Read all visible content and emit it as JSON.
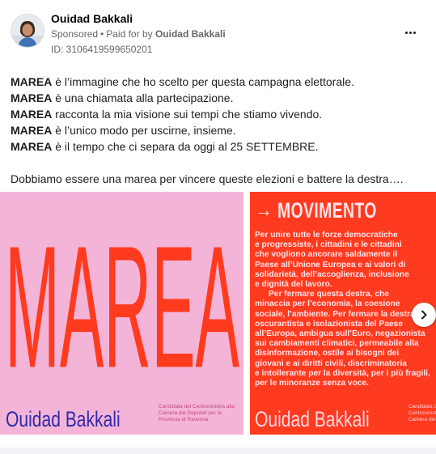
{
  "post": {
    "page_name": "Ouidad Bakkali",
    "sponsored": "Sponsored",
    "paid_for_prefix": "Paid for by",
    "paid_for_by": "Ouidad Bakkali",
    "ad_id": "ID: 3106419599650201",
    "body_lines": [
      {
        "bold": "MAREA",
        "rest": " è l’immagine che ho scelto per questa campagna elettorale."
      },
      {
        "bold": "MAREA",
        "rest": " è una chiamata alla partecipazione."
      },
      {
        "bold": "MAREA",
        "rest": " racconta la mia visione sui tempi che stiamo vivendo."
      },
      {
        "bold": "MAREA",
        "rest": " è l’unico modo per uscirne, insieme."
      },
      {
        "bold": "MAREA",
        "rest": " è il tempo che ci separa da oggi al 25 SETTEMBRE."
      }
    ],
    "body_closing": "Dobbiamo essere una marea per vincere queste elezioni e battere la destra…."
  },
  "carousel": {
    "slide_1": {
      "big_word": "MAREA",
      "name": "Ouidad Bakkali",
      "note": "Candidata del Centrosinistra alla Camera dei Deputati per la Provincia di Ravenna",
      "bg": "#f4b4d8",
      "word_color": "#ff3b1f"
    },
    "slide_2": {
      "title": "MOVIMENTO",
      "text": "Per unire tutte le forze democratiche\ne progressiste, i cittadini e le cittadini\nche vogliono ancorare saldamente il\nPaese all’Unione Europea e ai valori di\nsolidarietà, dell’accoglienza, inclusione\ne dignità del lavoro.\n      Per fermare questa destra, che\nminaccia per l’economia, la coesione\nsociale, l’ambiente. Per fermare la destra\noscurantista e isolazionista del Paese\nall’Europa, ambigua sull’Euro, negazionista\nsui cambiamenti climatici, permeabile alla\ndisinformazione, ostile ai bisogni dei\ngiovani e ai diritti civili, discriminatoria\ne intollerante per la diversità, per i più fragili,\nper le minoranze senza voce.",
      "name": "Ouidad Bakkali",
      "note": "Candidata del Centrosinistra alla Camera dei Deputati",
      "bg": "#ff3b1f"
    }
  }
}
